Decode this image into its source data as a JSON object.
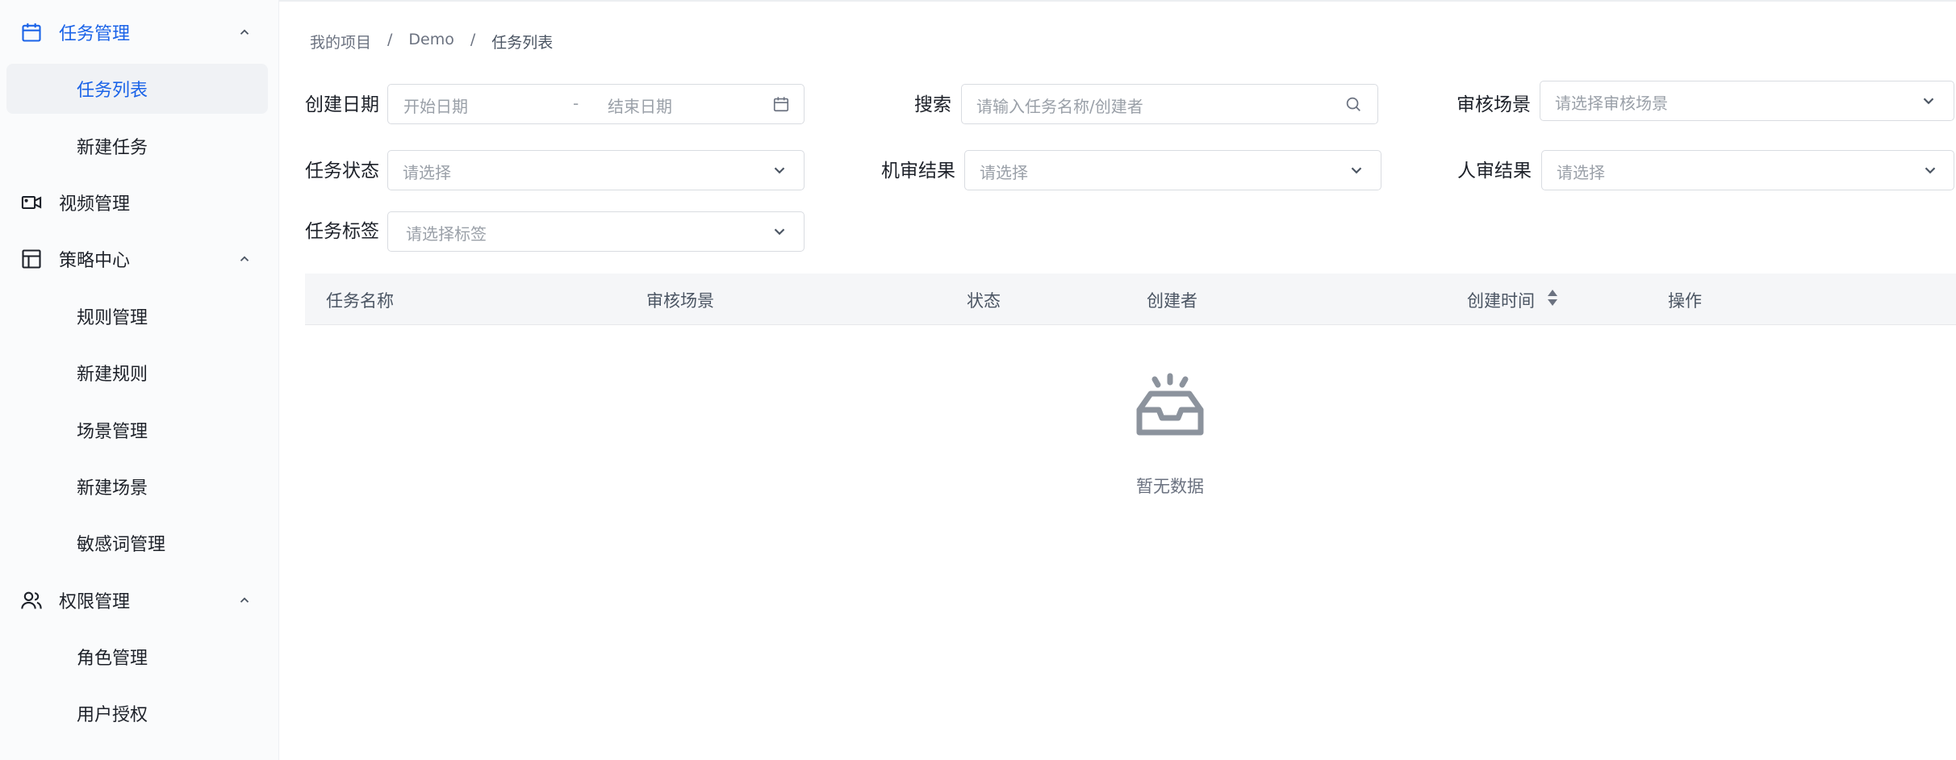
{
  "sidebar": {
    "groups": [
      {
        "label": "任务管理",
        "icon": "calendar-icon",
        "expanded": true,
        "items": [
          {
            "label": "任务列表",
            "selected": true
          },
          {
            "label": "新建任务"
          }
        ]
      },
      {
        "label": "视频管理",
        "icon": "video-camera-icon"
      },
      {
        "label": "策略中心",
        "icon": "layout-icon",
        "expanded": true,
        "items": [
          {
            "label": "规则管理"
          },
          {
            "label": "新建规则"
          },
          {
            "label": "场景管理"
          },
          {
            "label": "新建场景"
          },
          {
            "label": "敏感词管理"
          }
        ]
      },
      {
        "label": "权限管理",
        "icon": "users-icon",
        "expanded": true,
        "items": [
          {
            "label": "角色管理"
          },
          {
            "label": "用户授权"
          }
        ]
      }
    ]
  },
  "breadcrumb": [
    "我的项目",
    "Demo",
    "任务列表"
  ],
  "breadcrumb_separator": "/",
  "filters": {
    "create_date": {
      "label": "创建日期",
      "start_placeholder": "开始日期",
      "separator": "-",
      "end_placeholder": "结束日期"
    },
    "search": {
      "label": "搜索",
      "placeholder": "请输入任务名称/创建者"
    },
    "review_scene": {
      "label": "审核场景",
      "placeholder": "请选择审核场景"
    },
    "task_status": {
      "label": "任务状态",
      "placeholder": "请选择"
    },
    "machine_result": {
      "label": "机审结果",
      "placeholder": "请选择"
    },
    "human_result": {
      "label": "人审结果",
      "placeholder": "请选择"
    },
    "task_tag": {
      "label": "任务标签",
      "placeholder": "请选择标签"
    }
  },
  "table": {
    "columns": [
      "任务名称",
      "审核场景",
      "状态",
      "创建者",
      "创建时间",
      "操作"
    ],
    "rows": [],
    "empty_text": "暂无数据"
  },
  "colors": {
    "accent": "#1a63e8",
    "sidebar_bg": "#fafbfc",
    "header_bg": "#f5f6f8"
  }
}
